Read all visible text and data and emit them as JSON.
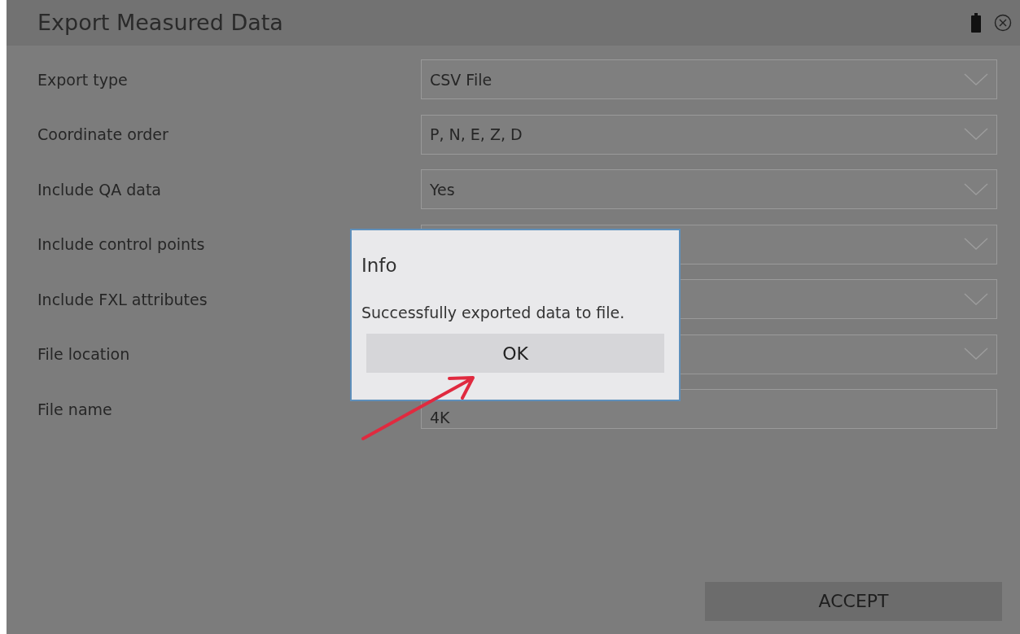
{
  "window": {
    "title": "Export Measured Data"
  },
  "fields": [
    {
      "label": "Export type",
      "kind": "select",
      "value": "CSV File"
    },
    {
      "label": "Coordinate order",
      "kind": "select",
      "value": "P, N, E, Z, D"
    },
    {
      "label": "Include QA data",
      "kind": "select",
      "value": "Yes"
    },
    {
      "label": "Include control points",
      "kind": "select"
    },
    {
      "label": "Include FXL attributes",
      "kind": "select"
    },
    {
      "label": "File location",
      "kind": "select"
    },
    {
      "label": "File name",
      "kind": "text",
      "value": "4K"
    }
  ],
  "accept_button": "ACCEPT",
  "dialog": {
    "title": "Info",
    "message": "Successfully exported data to file.",
    "button": "OK"
  }
}
